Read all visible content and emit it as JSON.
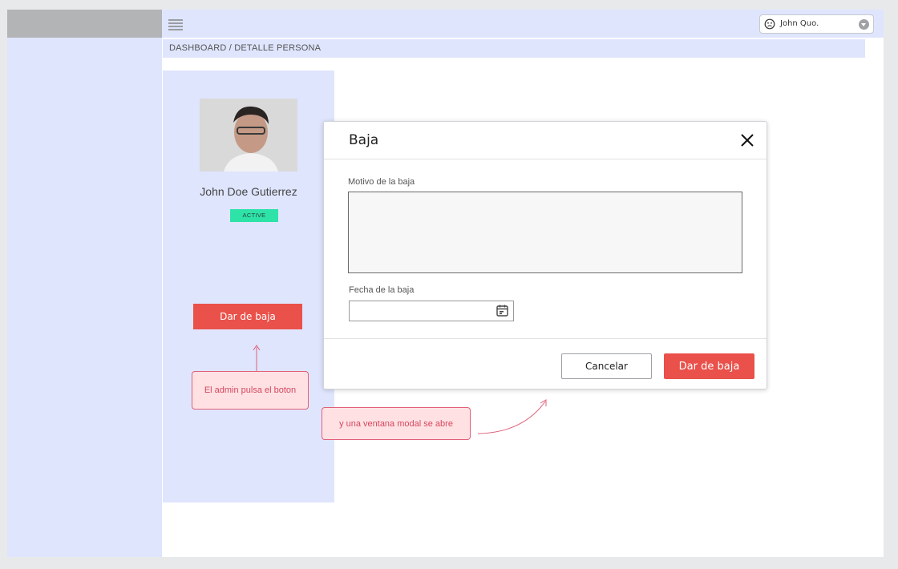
{
  "header": {
    "menu_icon": "hamburger-icon",
    "user": {
      "name": "John Quo.",
      "icon": "user-face-icon",
      "caret_icon": "chevron-down-icon"
    }
  },
  "breadcrumb": "DASHBOARD / DETALLE PERSONA",
  "profile": {
    "name": "John Doe Gutierrez",
    "status": "ACTIVE",
    "action_label": "Dar de baja"
  },
  "modal": {
    "title": "Baja",
    "close_icon": "close-icon",
    "reason_label": "Motivo de la baja",
    "reason_value": "",
    "date_label": "Fecha de la baja",
    "date_value": "",
    "calendar_icon": "calendar-icon",
    "cancel_label": "Cancelar",
    "confirm_label": "Dar de baja"
  },
  "annotations": {
    "note_1": "El admin pulsa el boton",
    "note_2": "y una ventana modal se abre"
  },
  "colors": {
    "accent_red": "#e9514a",
    "panel_blue": "#dfe5fd",
    "status_green": "#2ee3a8",
    "note_pink": "#ffe1e3"
  }
}
